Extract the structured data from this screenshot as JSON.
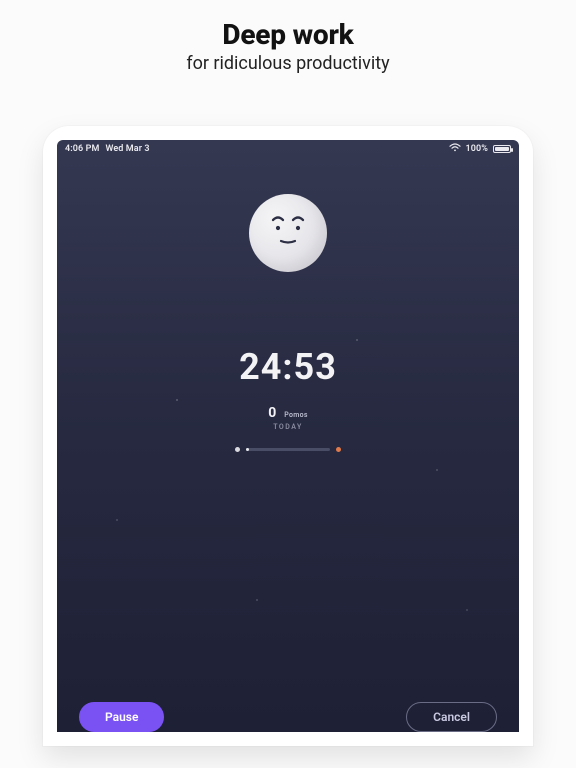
{
  "headline": {
    "title": "Deep work",
    "subtitle": "for ridiculous productivity"
  },
  "statusbar": {
    "time": "4:06 PM",
    "date": "Wed Mar 3",
    "battery_pct": "100%"
  },
  "timer": {
    "time": "24:53",
    "pomos_count": "0",
    "pomos_unit": "Pomos",
    "today_label": "TODAY"
  },
  "buttons": {
    "pause": "Pause",
    "cancel": "Cancel"
  },
  "colors": {
    "accent_button": "#7a52f4",
    "accent_progress_end": "#e07a4b",
    "screen_bg_top": "#343851",
    "screen_bg_bottom": "#1e2035"
  }
}
